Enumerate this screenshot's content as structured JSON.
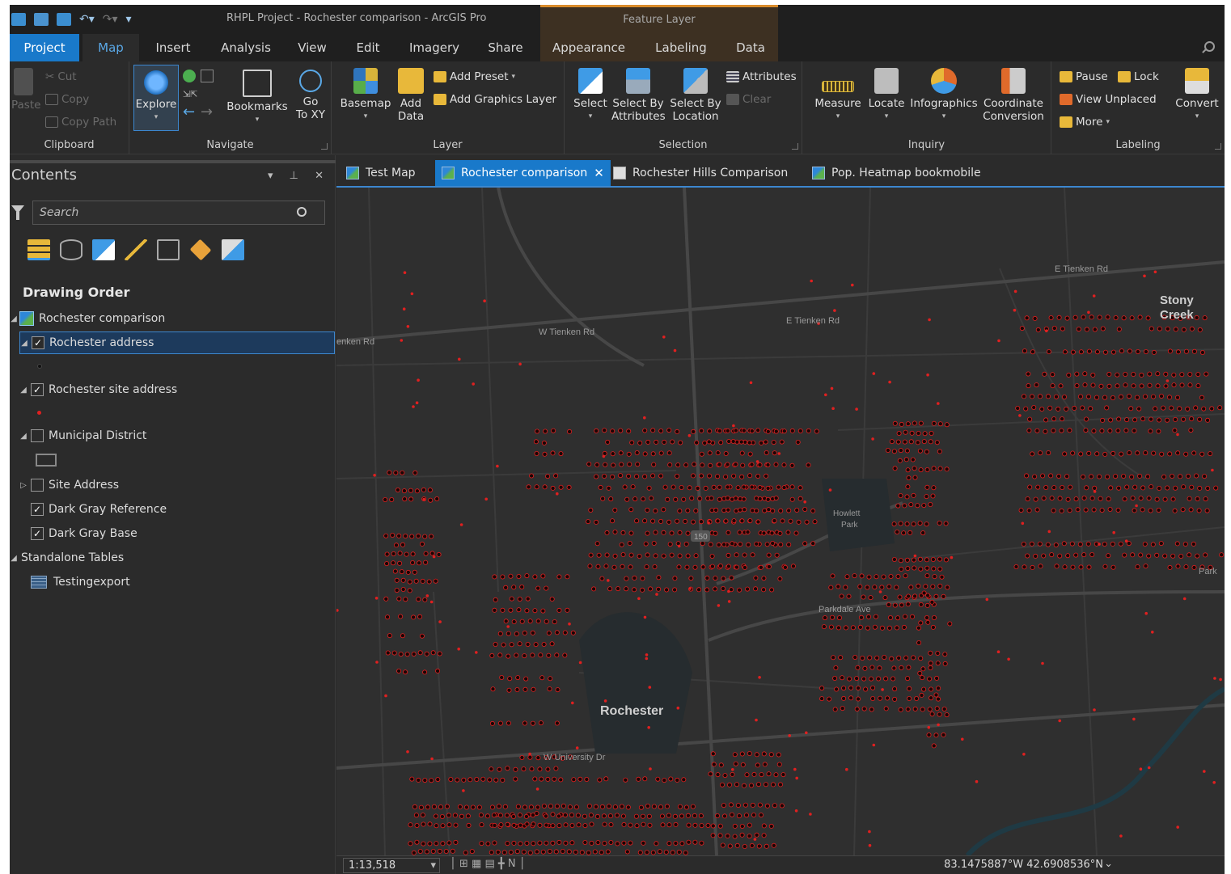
{
  "window": {
    "title": "RHPL Project - Rochester comparison - ArcGIS Pro",
    "contextual_tab_header": "Feature Layer"
  },
  "ribbon_tabs": [
    "Project",
    "Map",
    "Insert",
    "Analysis",
    "View",
    "Edit",
    "Imagery",
    "Share",
    "Appearance",
    "Labeling",
    "Data"
  ],
  "active_tab": "Map",
  "ribbon": {
    "clipboard": {
      "label": "Clipboard",
      "paste": "Paste",
      "cut": "Cut",
      "copy": "Copy",
      "copy_path": "Copy Path"
    },
    "navigate": {
      "label": "Navigate",
      "explore": "Explore",
      "bookmarks": "Bookmarks",
      "go_to_xy_1": "Go",
      "go_to_xy_2": "To XY"
    },
    "layer": {
      "label": "Layer",
      "basemap": "Basemap",
      "add_data_1": "Add",
      "add_data_2": "Data",
      "add_preset": "Add Preset",
      "add_graphics_layer": "Add Graphics Layer"
    },
    "selection": {
      "label": "Selection",
      "select": "Select",
      "select_by_attr_1": "Select By",
      "select_by_attr_2": "Attributes",
      "select_by_loc_1": "Select By",
      "select_by_loc_2": "Location",
      "attributes": "Attributes",
      "clear": "Clear"
    },
    "inquiry": {
      "label": "Inquiry",
      "measure": "Measure",
      "locate": "Locate",
      "infographics": "Infographics",
      "coord_1": "Coordinate",
      "coord_2": "Conversion"
    },
    "labeling": {
      "label": "Labeling",
      "pause": "Pause",
      "lock": "Lock",
      "view_unplaced": "View Unplaced",
      "more": "More",
      "convert": "Convert"
    }
  },
  "contents": {
    "title": "Contents",
    "search_placeholder": "Search",
    "drawing_order": "Drawing Order",
    "items": [
      {
        "label": "Rochester comparison",
        "checked": null
      },
      {
        "label": "Rochester address",
        "checked": true
      },
      {
        "label": "Rochester site address",
        "checked": true
      },
      {
        "label": "Municipal District",
        "checked": false
      },
      {
        "label": "Site Address",
        "checked": false
      },
      {
        "label": "Dark Gray Reference",
        "checked": true
      },
      {
        "label": "Dark Gray Base",
        "checked": true
      },
      {
        "label": "Standalone Tables",
        "checked": null
      },
      {
        "label": "Testingexport",
        "checked": null
      }
    ]
  },
  "map_tabs": [
    {
      "label": "Test Map",
      "active": false
    },
    {
      "label": "Rochester comparison",
      "active": true
    },
    {
      "label": "Rochester Hills Comparison",
      "active": false
    },
    {
      "label": "Pop. Heatmap bookmobile",
      "active": false
    }
  ],
  "map_labels": {
    "e_tienken_rd_1": "E Tienken Rd",
    "e_tienken_rd_2": "E Tienken Rd",
    "w_tienken_rd": "W Tienken Rd",
    "tienken_rd_cut": "enken Rd",
    "stony_creek_1": "Stony",
    "stony_creek_2": "Creek",
    "howlett_1": "Howlett",
    "howlett_2": "Park",
    "route": "150",
    "parkdale": "Parkdale Ave",
    "park_cut": "Park",
    "rochester": "Rochester",
    "w_university": "W University Dr"
  },
  "status": {
    "scale": "1:13,518",
    "coordinates": "83.1475887°W 42.6908536°N"
  },
  "colors": {
    "accent": "#1979ca",
    "point": "#e02020",
    "point_dark": "#1a0505"
  }
}
